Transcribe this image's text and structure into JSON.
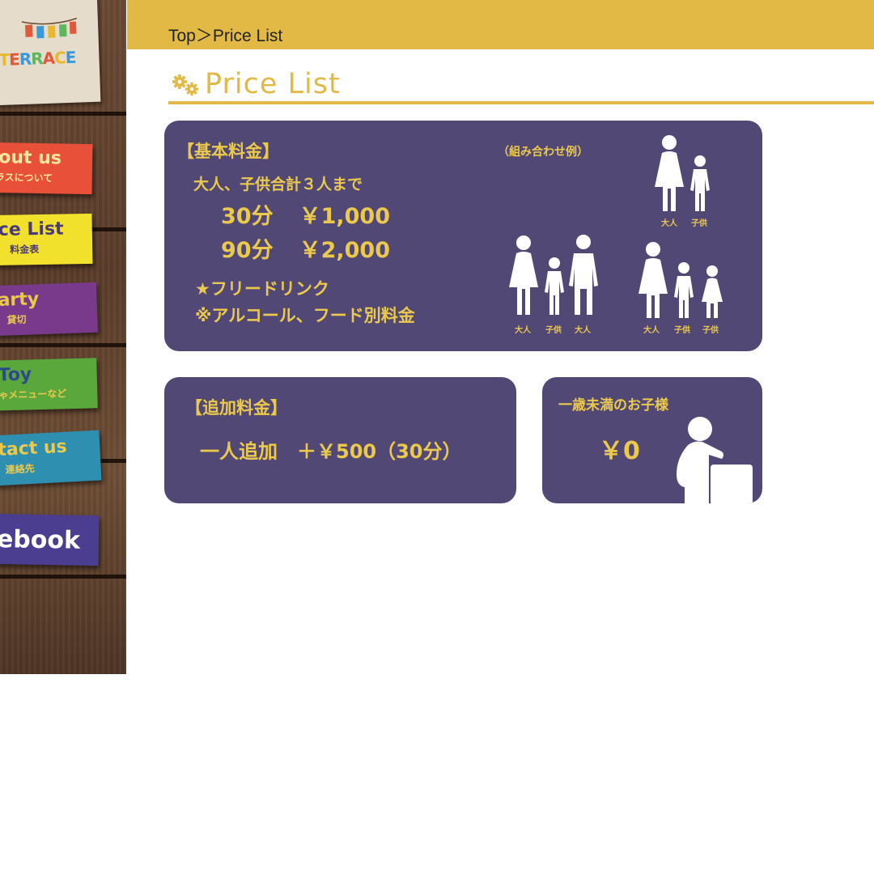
{
  "sidebar": {
    "logo": {
      "text": "TERRACE",
      "brand_colors": [
        "#e05a3a",
        "#3a9ad9",
        "#e8b92c",
        "#5cb85c"
      ]
    },
    "items": [
      {
        "label": "out us",
        "sub": "ラスについて",
        "color": "#e8503a"
      },
      {
        "label": "ce List",
        "sub": "料金表",
        "color": "#f2e12c"
      },
      {
        "label": "arty",
        "sub": "貸切",
        "color": "#7a3a8c"
      },
      {
        "label": "Toy",
        "sub": "ゃメニューなど",
        "color": "#5aa83c"
      },
      {
        "label": "tact us",
        "sub": "連絡先",
        "color": "#2f8fb0"
      },
      {
        "label": "ebook",
        "sub": "",
        "color": "#4b3d8f"
      }
    ]
  },
  "breadcrumb": {
    "home": "Top",
    "separator": "＞",
    "current": "Price List"
  },
  "page": {
    "title": "Price List",
    "title_icon": "gears-icon",
    "accent_color": "#e3b945",
    "panel_color": "#524876",
    "text_color": "#eac94c"
  },
  "basic": {
    "heading": "【基本料金】",
    "condition": "大人、子供合計３人まで",
    "prices": [
      {
        "time": "30分",
        "price": "￥1,000"
      },
      {
        "time": "90分",
        "price": "￥2,000"
      }
    ],
    "note1": "★フリードリンク",
    "note2": "※アルコール、フード別料金",
    "examples_title": "（組み合わせ例）",
    "examples": [
      {
        "labels": [
          "大人",
          "子供"
        ]
      },
      {
        "labels": [
          "大人",
          "子供",
          "大人"
        ]
      },
      {
        "labels": [
          "大人",
          "子供",
          "子供"
        ]
      }
    ]
  },
  "additional": {
    "heading": "【追加料金】",
    "line": "一人追加　＋￥500（30分）"
  },
  "infant": {
    "heading": "一歳未満のお子様",
    "price": "￥0",
    "icon": "baby-standing-icon"
  }
}
